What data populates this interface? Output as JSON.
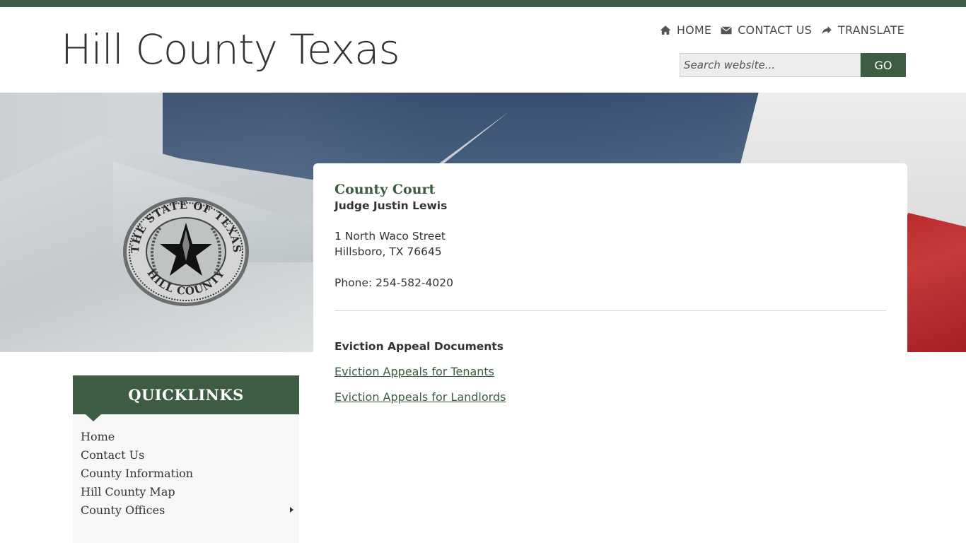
{
  "site": {
    "title": "Hill County Texas"
  },
  "top_nav": {
    "items": [
      {
        "label": "HOME",
        "icon": "home-icon"
      },
      {
        "label": "CONTACT US",
        "icon": "envelope-icon"
      },
      {
        "label": "TRANSLATE",
        "icon": "share-arrow-icon"
      }
    ]
  },
  "search": {
    "placeholder": "Search website...",
    "button_label": "GO"
  },
  "hero": {
    "seal_icon": "state-seal-icon",
    "seal_text_top": "THE STATE OF TEXAS",
    "seal_text_bottom": "HILL COUNTY"
  },
  "content": {
    "heading": "County Court",
    "judge": "Judge Justin Lewis",
    "address_line1": "1 North Waco Street",
    "address_line2": "Hillsboro, TX 76645",
    "phone": "Phone: 254-582-4020",
    "section_title": "Eviction Appeal Documents",
    "links": [
      {
        "label": "Eviction Appeals for Tenants"
      },
      {
        "label": "Eviction Appeals for Landlords"
      }
    ]
  },
  "quicklinks": {
    "title": "QUICKLINKS",
    "items": [
      {
        "label": "Home"
      },
      {
        "label": "Contact Us"
      },
      {
        "label": "County Information"
      },
      {
        "label": "Hill County Map"
      },
      {
        "label": "County Offices"
      }
    ]
  },
  "colors": {
    "brand_green": "#3d5c42",
    "link_green": "#3d5c42"
  }
}
